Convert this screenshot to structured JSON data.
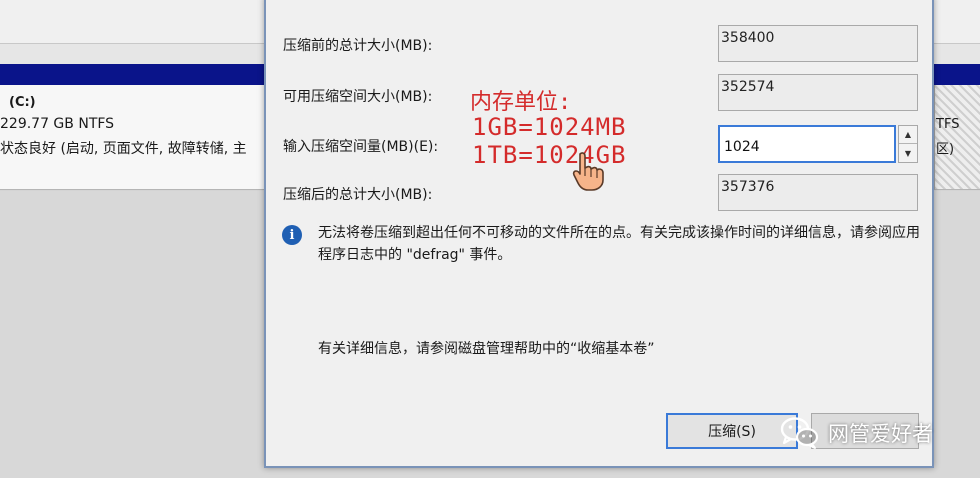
{
  "background": {
    "volume": {
      "name": "(C:)",
      "size_fs": "229.77 GB NTFS",
      "status": "状态良好 (启动, 页面文件, 故障转储, 主",
      "right_fs": "TFS",
      "right_note": "区)"
    }
  },
  "dialog": {
    "fields": [
      {
        "label": "压缩前的总计大小(MB):",
        "value": "358400"
      },
      {
        "label": "可用压缩空间大小(MB):",
        "value": "352574"
      },
      {
        "label": "输入压缩空间量(MB)(E):",
        "value": "1024"
      },
      {
        "label": "压缩后的总计大小(MB):",
        "value": "357376"
      }
    ],
    "info_text": "无法将卷压缩到超出任何不可移动的文件所在的点。有关完成该操作时间的详细信息，请参阅应用程序日志中的 \"defrag\" 事件。",
    "help_text": "有关详细信息，请参阅磁盘管理帮助中的“收缩基本卷”",
    "primary_button": "压缩(S)"
  },
  "annotation": {
    "title": "内存单位:",
    "line1": "1GB=1024MB",
    "line2": "1TB=1024GB",
    "color": "#d42b2b"
  },
  "watermark": {
    "text": "网管爱好者"
  },
  "colors": {
    "accent": "#3a7ad8",
    "info_icon": "#1f5fb3",
    "title_bar": "#0a148a"
  },
  "icons": {
    "info": "info-icon",
    "spinner_up": "chevron-up-icon",
    "spinner_down": "chevron-down-icon",
    "cursor": "hand-pointer-icon",
    "watermark_logo": "wechat-logo-icon"
  }
}
